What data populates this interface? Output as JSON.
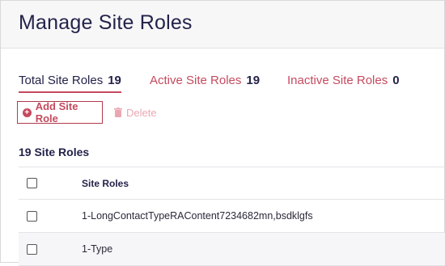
{
  "page": {
    "title": "Manage Site Roles"
  },
  "tabs": [
    {
      "label": "Total Site Roles",
      "count": "19"
    },
    {
      "label": "Active Site Roles",
      "count": "19"
    },
    {
      "label": "Inactive Site Roles",
      "count": "0"
    }
  ],
  "toolbar": {
    "add_label": "Add Site Role",
    "delete_label": "Delete"
  },
  "list": {
    "count_title": "19 Site Roles",
    "column_header": "Site Roles",
    "rows": [
      {
        "name": "1-LongContactTypeRAContent7234682mn,bsdklgfs"
      },
      {
        "name": "1-Type"
      }
    ]
  },
  "colors": {
    "accent": "#c54a5f",
    "navy": "#23234a",
    "delete_disabled": "#eaa7b2"
  }
}
